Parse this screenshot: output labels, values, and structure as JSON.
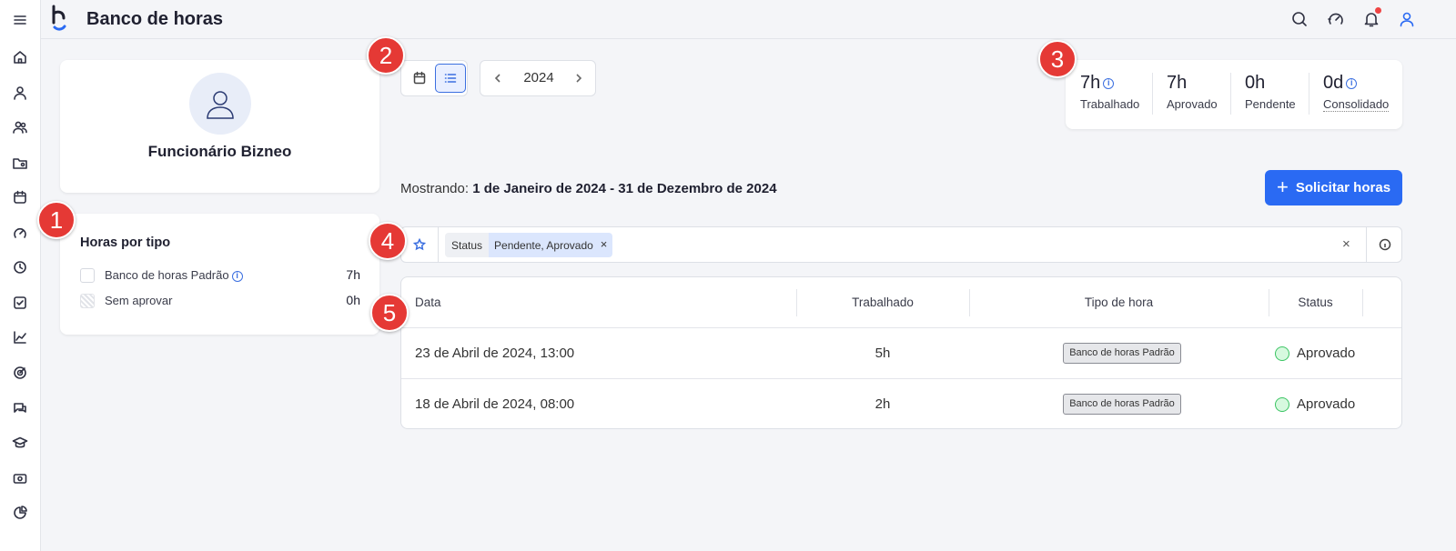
{
  "header": {
    "title": "Banco de horas"
  },
  "sidebar": {
    "icons": [
      "menu-icon",
      "home-icon",
      "user-icon",
      "users-icon",
      "folder-user-icon",
      "calendar-icon",
      "speed-icon",
      "clock-icon",
      "checklist-icon",
      "chart-icon",
      "target-icon",
      "chat-icon",
      "graduation-icon",
      "money-icon",
      "pie-chart-icon"
    ]
  },
  "profile": {
    "name": "Funcionário Bizneo"
  },
  "hours_by_type": {
    "title": "Horas por tipo",
    "items": [
      {
        "label": "Banco de horas Padrão",
        "value": "7h"
      },
      {
        "label": "Sem aprovar",
        "value": "0h"
      }
    ]
  },
  "year_nav": {
    "year": "2024"
  },
  "stats": [
    {
      "value": "7h",
      "label": "Trabalhado"
    },
    {
      "value": "7h",
      "label": "Aprovado"
    },
    {
      "value": "0h",
      "label": "Pendente"
    },
    {
      "value": "0d",
      "label": "Consolidado"
    }
  ],
  "showing": {
    "prefix": "Mostrando:",
    "range": "1 de Janeiro de 2024 - 31 de Dezembro de 2024"
  },
  "request_button": {
    "label": "Solicitar horas"
  },
  "filter": {
    "key": "Status",
    "value": "Pendente, Aprovado",
    "clear": "×"
  },
  "table": {
    "headers": [
      "Data",
      "Trabalhado",
      "Tipo de hora",
      "Status"
    ],
    "rows": [
      {
        "date": "23 de Abril de 2024, 13:00",
        "worked": "5h",
        "type": "Banco de horas Padrão",
        "status": "Aprovado"
      },
      {
        "date": "18 de Abril de 2024, 08:00",
        "worked": "2h",
        "type": "Banco de horas Padrão",
        "status": "Aprovado"
      }
    ]
  },
  "markers": [
    "1",
    "2",
    "3",
    "4",
    "5"
  ],
  "colors": {
    "primary": "#2a6af3",
    "marker": "#e53935",
    "status_approved": "#3bc463"
  }
}
